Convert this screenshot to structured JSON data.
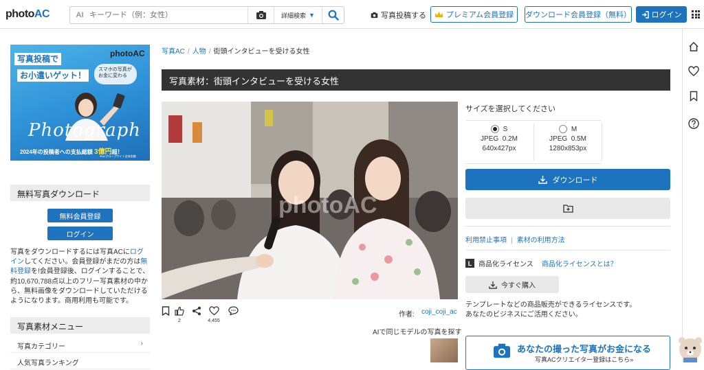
{
  "header": {
    "logo_photo": "photo",
    "logo_ac": "AC",
    "ai_badge": "AI",
    "search_placeholder": "キーワード（例：女性）",
    "detail_search": "詳細検索",
    "post_photo": "写真投稿する",
    "premium": "プレミアム会員登録",
    "dl_register": "ダウンロード会員登録（無料）",
    "login": "ログイン",
    "accent": "#1e73be"
  },
  "banner": {
    "tag1": "写真投稿で",
    "tag2": "お小遣いゲット！",
    "logo": "photoAC",
    "bubble": "スマホの写真が お金に変わる",
    "script": "Photograph",
    "caption_a": "2024年の投稿者への支払総額",
    "caption_b": "3億円",
    "caption_c": "超！",
    "foot": "※ACグループサイト全体金額"
  },
  "sidebar": {
    "download_heading": "無料写真ダウンロード",
    "free_register": "無料会員登録",
    "login": "ログイン",
    "text_1": "写真をダウンロードするには写真ACに",
    "text_login": "ログイン",
    "text_2": "してください。会員登録がまだの方は",
    "text_free": "無料登録",
    "text_3": "を!会員登録後、ログインすることで、約10,670,788点以上のフリー写真素材の中から、無料画像をダウンロードしていただけるようになります。商用利用も可能です。",
    "menu_heading": "写真素材メニュー",
    "menu_items": [
      {
        "label": "写真カテゴリー",
        "chevron": "›"
      },
      {
        "label": "人気写真ランキング",
        "chevron": ""
      }
    ]
  },
  "breadcrumb": {
    "items": [
      "写真AC",
      "人物"
    ],
    "current": "街頭インタビューを受ける女性",
    "sep": "/"
  },
  "page_title": "写真素材：街頭インタビューを受ける女性",
  "photo": {
    "watermark": "photoAC"
  },
  "actions": {
    "like_count": "2",
    "fav_count": "4,455",
    "author_label": "作者:",
    "author_name": "coji_coji_ac",
    "ai_same_model": "AIで同じモデルの写真を探す"
  },
  "download_panel": {
    "size_heading": "サイズを選択してください",
    "sizes": [
      {
        "name": "S",
        "format": "JPEG",
        "filesize": "0.2M",
        "dims": "640x427px",
        "selected": true
      },
      {
        "name": "M",
        "format": "JPEG",
        "filesize": "0.5M",
        "dims": "1280x853px",
        "selected": false
      }
    ],
    "download_button": "ダウンロード",
    "prohibited": "利用禁止事項",
    "link_sep": "|",
    "usage": "素材の利用方法",
    "license_letter": "L",
    "license_label": "商品化ライセンス",
    "license_link": "商品化ライセンスとは？",
    "buy_now": "今すぐ購入",
    "license_desc_1": "テンプレートなどの商品販売ができるライセンスです。",
    "license_desc_2": "あなたのビジネスにご活用ください。",
    "promo_main": "あなたの撮った写真がお金になる",
    "promo_sub": "写真ACクリエイター登録はこちら»"
  }
}
